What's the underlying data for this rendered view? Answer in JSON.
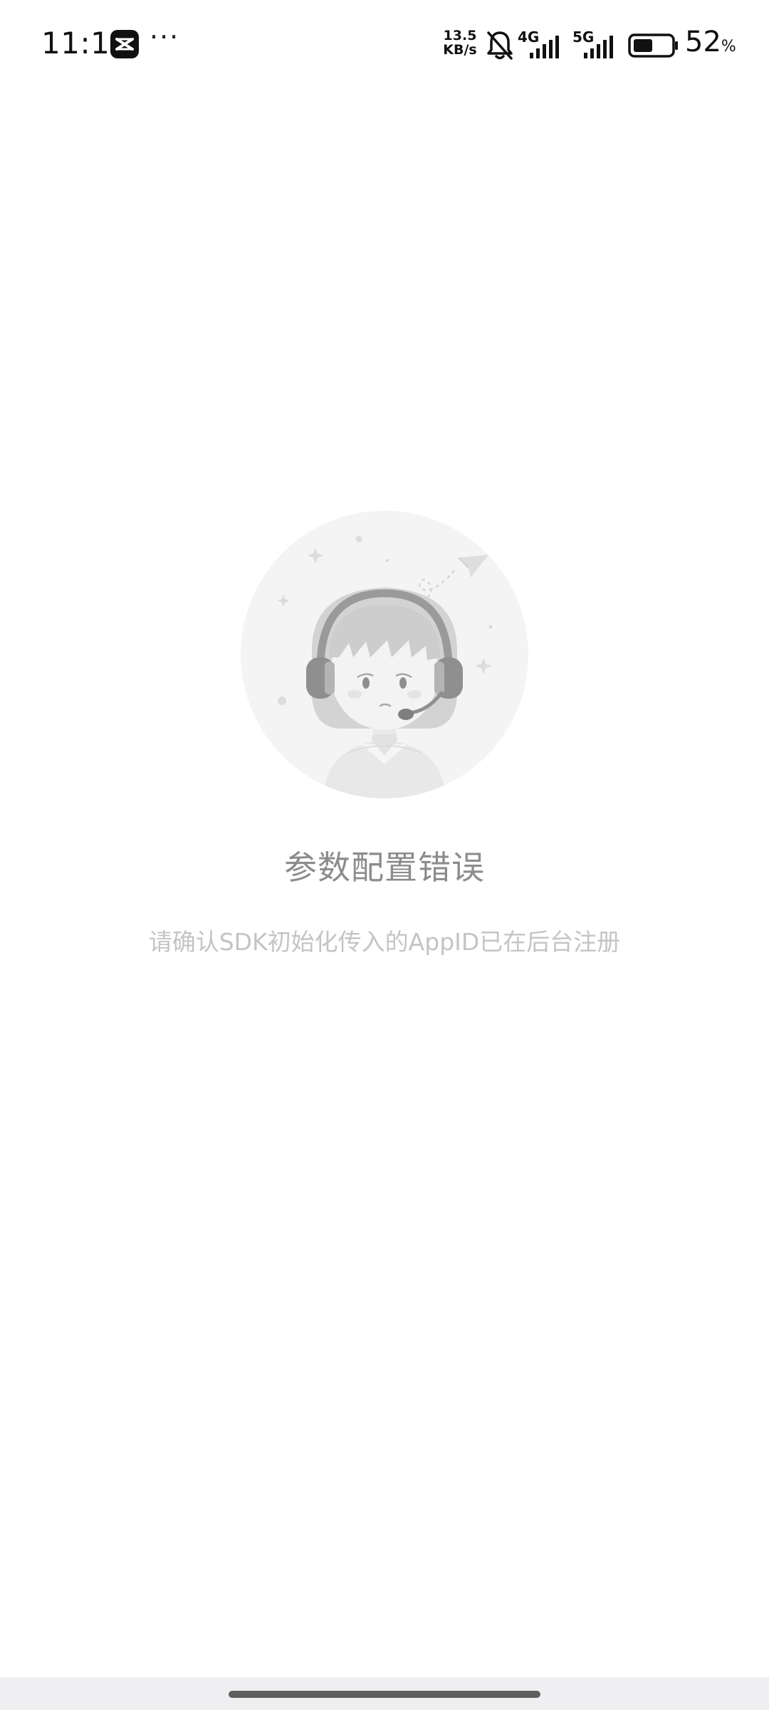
{
  "status_bar": {
    "time": "11:11",
    "more": "···",
    "net_speed_value": "13.5",
    "net_speed_unit": "KB/s",
    "sig1_label": "4G",
    "sig2_label": "5G",
    "battery_percent": "52",
    "battery_unit": "%",
    "battery_level": 0.52
  },
  "content": {
    "title": "参数配置错误",
    "description": "请确认SDK初始化传入的AppID已在后台注册"
  },
  "colors": {
    "title": "#8c8c8c",
    "description": "#c4c4c4",
    "illustration_bg": "#f4f4f4"
  }
}
